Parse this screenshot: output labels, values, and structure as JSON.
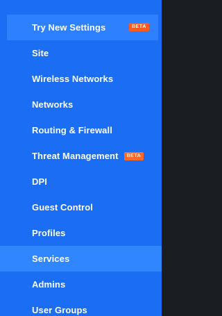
{
  "top": {
    "label": "Try New Settings",
    "badge": "BETA"
  },
  "nav": {
    "items": [
      {
        "label": "Site"
      },
      {
        "label": "Wireless Networks"
      },
      {
        "label": "Networks"
      },
      {
        "label": "Routing & Firewall"
      },
      {
        "label": "Threat Management",
        "badge": "BETA"
      },
      {
        "label": "DPI"
      },
      {
        "label": "Guest Control"
      },
      {
        "label": "Profiles"
      },
      {
        "label": "Services",
        "active": true
      },
      {
        "label": "Admins"
      },
      {
        "label": "User Groups"
      }
    ]
  },
  "colors": {
    "sidebar_bg": "#1b6ef3",
    "active_bg": "#2f86ff",
    "badge_bg": "#ff5b1f",
    "outer_bg": "#1a1d22"
  }
}
